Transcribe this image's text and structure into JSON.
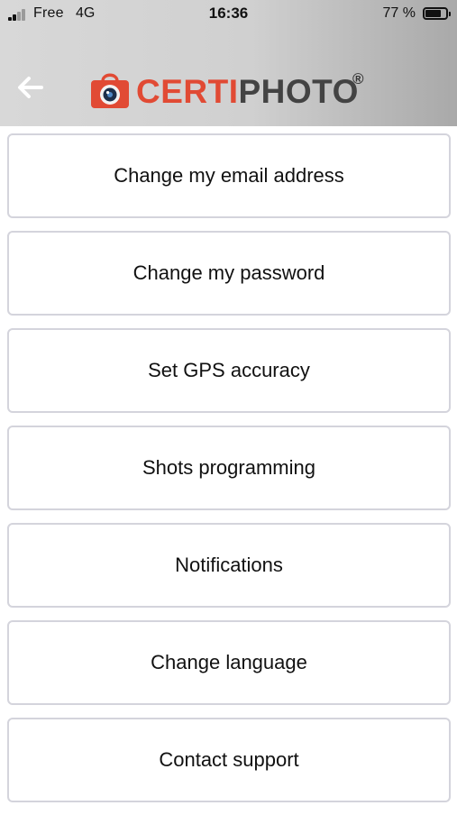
{
  "status_bar": {
    "carrier": "Free",
    "network": "4G",
    "time": "16:36",
    "battery_percent_label": "77 %",
    "battery_level": 0.77
  },
  "header": {
    "back_icon": "arrow-left-icon",
    "logo": {
      "icon": "camera-bag-icon",
      "text_part1": "CERTI",
      "text_part2": "PHOTO",
      "registered": "®"
    },
    "colors": {
      "brand_red": "#e14a34",
      "brand_dark": "#434343"
    }
  },
  "menu": {
    "items": [
      {
        "label": "Change my email address"
      },
      {
        "label": "Change my password"
      },
      {
        "label": "Set GPS accuracy"
      },
      {
        "label": "Shots programming"
      },
      {
        "label": "Notifications"
      },
      {
        "label": "Change language"
      },
      {
        "label": "Contact support"
      }
    ]
  }
}
